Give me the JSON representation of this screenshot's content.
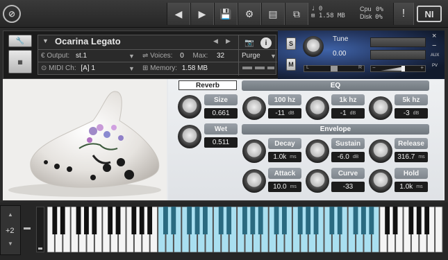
{
  "topbar": {
    "logo_glyph": "⊘",
    "stats": {
      "midi": "0",
      "memory": "1.58 MB"
    },
    "cpu_label": "Cpu",
    "cpu_value": "0%",
    "disk_label": "Disk",
    "disk_value": "0%",
    "warning": "!",
    "brand": "NI"
  },
  "instrument": {
    "name": "Ocarina Legato",
    "output_label": "Output:",
    "output_value": "st.1",
    "voices_label": "Voices:",
    "voices_value": "0",
    "max_label": "Max:",
    "max_value": "32",
    "purge_label": "Purge",
    "midi_label": "MIDI Ch:",
    "midi_value": "[A]  1",
    "memory_label": "Memory:",
    "memory_value": "1.58 MB",
    "s_label": "S",
    "m_label": "M",
    "tune_label": "Tune",
    "tune_value": "0.00",
    "pan_l": "L",
    "pan_r": "R",
    "aux_label": "AUX",
    "pv_label": "PV",
    "close": "×",
    "minus": "−",
    "plus": "+"
  },
  "panel": {
    "reverb_button": "Reverb",
    "size": {
      "label": "Size",
      "value": "0.661"
    },
    "wet": {
      "label": "Wet",
      "value": "0.511"
    },
    "eq_title": "EQ",
    "eq": [
      {
        "label": "100 hz",
        "value": "-11",
        "unit": "dB"
      },
      {
        "label": "1k hz",
        "value": "-1",
        "unit": "dB"
      },
      {
        "label": "5k hz",
        "value": "-3",
        "unit": "dB"
      }
    ],
    "env_title": "Envelope",
    "env_row1": [
      {
        "label": "Decay",
        "value": "1.0k",
        "unit": "ms"
      },
      {
        "label": "Sustain",
        "value": "-6.0",
        "unit": "dB"
      },
      {
        "label": "Release",
        "value": "316.7",
        "unit": "ms"
      }
    ],
    "env_row2": [
      {
        "label": "Attack",
        "value": "10.0",
        "unit": "ms"
      },
      {
        "label": "Curve",
        "value": "-33",
        "unit": ""
      },
      {
        "label": "Hold",
        "value": "1.0k",
        "unit": "ms"
      }
    ]
  },
  "keyboard": {
    "octave": "+2",
    "up": "▲",
    "down": "▼",
    "minus": "−"
  }
}
